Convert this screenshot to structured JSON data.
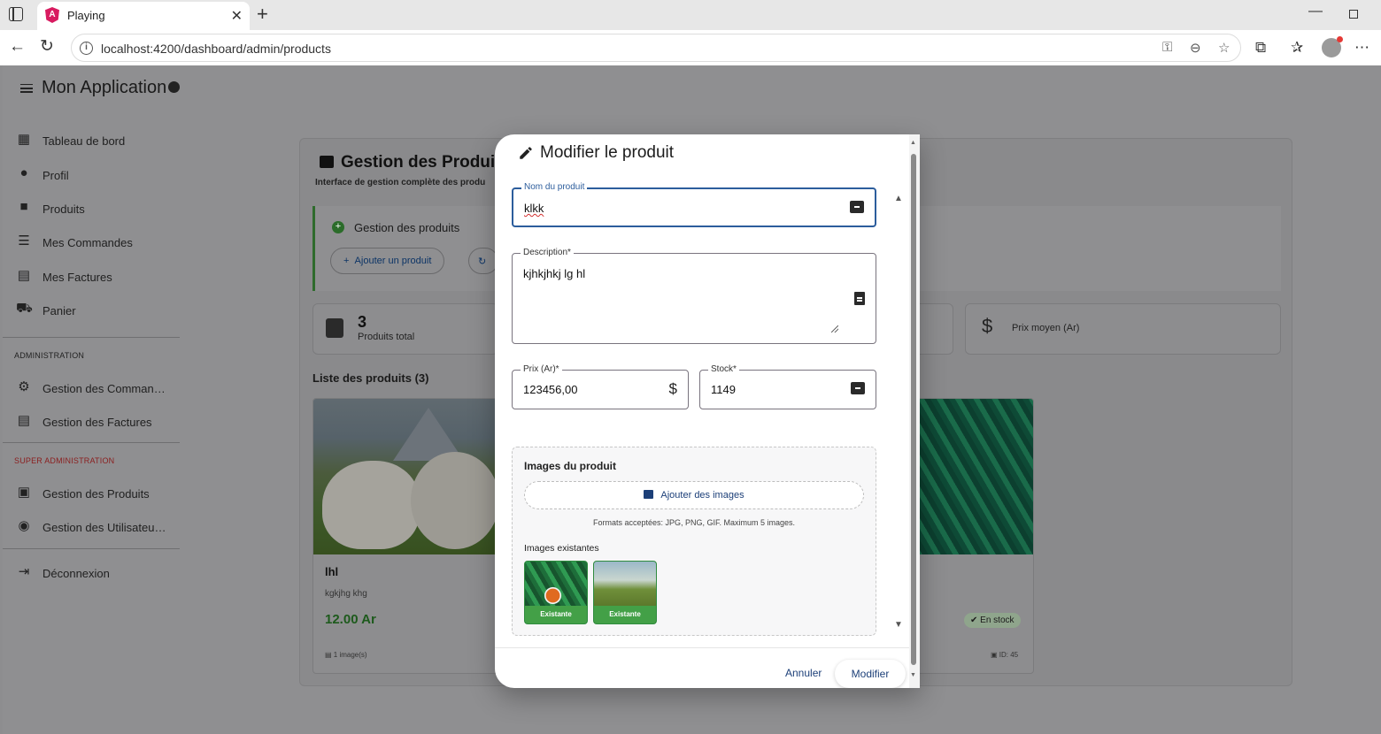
{
  "browser": {
    "tab_title": "Playing",
    "url": "localhost:4200/dashboard/admin/products"
  },
  "app": {
    "title": "Mon Application",
    "nav": {
      "main": [
        {
          "label": "Tableau de bord",
          "icon": "dashboard-icon"
        },
        {
          "label": "Profil",
          "icon": "person-icon"
        },
        {
          "label": "Produits",
          "icon": "shopping-bag-icon"
        },
        {
          "label": "Mes Commandes",
          "icon": "list-icon"
        },
        {
          "label": "Mes Factures",
          "icon": "receipt-icon"
        },
        {
          "label": "Panier",
          "icon": "cart-icon"
        }
      ],
      "admin_section": "ADMINISTRATION",
      "admin": [
        {
          "label": "Gestion des Comman…",
          "icon": "manage-accounts-icon"
        },
        {
          "label": "Gestion des Factures",
          "icon": "receipt-icon"
        }
      ],
      "super_section": "SUPER ADMINISTRATION",
      "super": [
        {
          "label": "Gestion des Produits",
          "icon": "inventory-icon"
        },
        {
          "label": "Gestion des Utilisateu…",
          "icon": "admin-panel-icon"
        }
      ],
      "logout": {
        "label": "Déconnexion",
        "icon": "logout-icon"
      }
    }
  },
  "background": {
    "title": "Gestion des Produits",
    "subtitle": "Interface de gestion complète des produ",
    "panel_title": "Gestion des produits",
    "add_button": "Ajouter un produit",
    "stats": {
      "total_count": "3",
      "total_label": "Produits total",
      "avg_price_label": "Prix moyen (Ar)"
    },
    "list_title": "Liste des produits (3)",
    "card1": {
      "name": "lhl",
      "desc": "kgkjhg khg",
      "price": "12.00 Ar",
      "images": "1 image(s)"
    },
    "card2": {
      "stock": "En stock",
      "id": "ID: 45"
    }
  },
  "dialog": {
    "title": "Modifier le produit",
    "name_label": "Nom du produit",
    "name_value": "klkk",
    "desc_label": "Description*",
    "desc_value": "kjhkjhkj lg hl",
    "price_label": "Prix (Ar)*",
    "price_value": "123456,00",
    "stock_label": "Stock*",
    "stock_value": "1149",
    "images_title": "Images du produit",
    "add_images": "Ajouter des images",
    "formats": "Formats acceptées: JPG, PNG, GIF. Maximum 5 images.",
    "existing_title": "Images existantes",
    "existing_badge": "Existante",
    "cancel": "Annuler",
    "submit": "Modifier"
  }
}
